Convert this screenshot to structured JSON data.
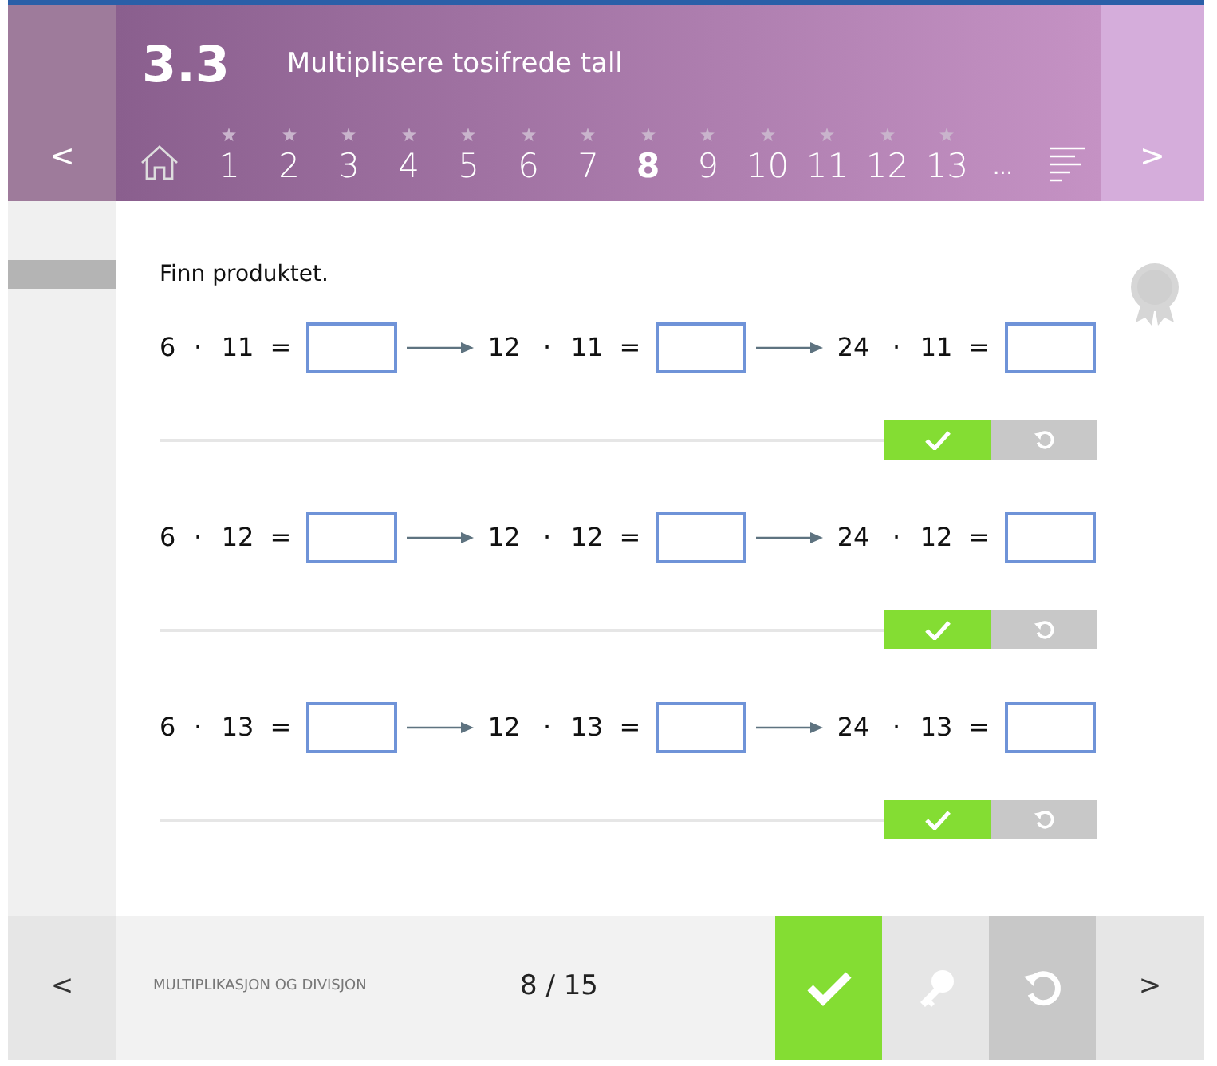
{
  "header": {
    "number": "3.3",
    "title": "Multiplisere tosifrede tall",
    "prev": "<",
    "next": ">",
    "more": "...",
    "pages": [
      {
        "label": "1",
        "selected": false
      },
      {
        "label": "2",
        "selected": false
      },
      {
        "label": "3",
        "selected": false
      },
      {
        "label": "4",
        "selected": false
      },
      {
        "label": "5",
        "selected": false
      },
      {
        "label": "6",
        "selected": false
      },
      {
        "label": "7",
        "selected": false
      },
      {
        "label": "8",
        "selected": true
      },
      {
        "label": "9",
        "selected": false
      },
      {
        "label": "10",
        "selected": false
      },
      {
        "label": "11",
        "selected": false
      },
      {
        "label": "12",
        "selected": false
      },
      {
        "label": "13",
        "selected": false
      }
    ]
  },
  "instruction": "Finn produktet.",
  "problems": [
    {
      "steps": [
        {
          "a": "6",
          "b": "11"
        },
        {
          "a": "12",
          "b": "11"
        },
        {
          "a": "24",
          "b": "11"
        }
      ]
    },
    {
      "steps": [
        {
          "a": "6",
          "b": "12"
        },
        {
          "a": "12",
          "b": "12"
        },
        {
          "a": "24",
          "b": "12"
        }
      ]
    },
    {
      "steps": [
        {
          "a": "6",
          "b": "13"
        },
        {
          "a": "12",
          "b": "13"
        },
        {
          "a": "24",
          "b": "13"
        }
      ]
    }
  ],
  "operator": "·",
  "equals": "=",
  "footer": {
    "prev": "<",
    "next": ">",
    "topic": "MULTIPLIKASJON OG DIVISJON",
    "counter": "8 / 15"
  }
}
